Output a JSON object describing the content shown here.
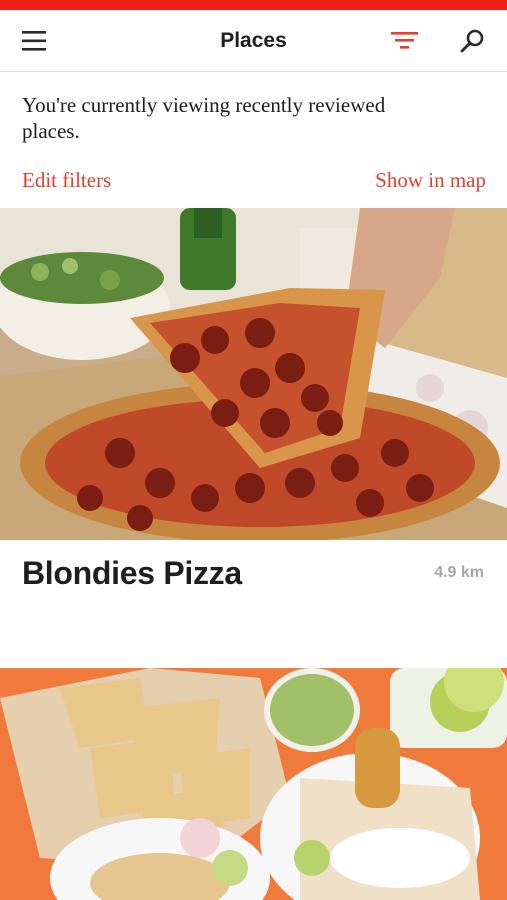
{
  "nav": {
    "title": "Places",
    "menu_icon": "hamburger-menu-icon",
    "filter_icon": "filter-icon",
    "search_icon": "search-icon",
    "accent_color": "#f01e14"
  },
  "info": {
    "message": "You're currently viewing recently reviewed places."
  },
  "actions": {
    "edit_filters": "Edit filters",
    "show_in_map": "Show in map",
    "link_color": "#e2402e"
  },
  "places": [
    {
      "name": "Blondies Pizza",
      "distance": "4.9 km",
      "photo": "pepperoni-pizza-photo"
    },
    {
      "name": "",
      "distance": "",
      "photo": "tacos-and-chips-photo"
    }
  ]
}
